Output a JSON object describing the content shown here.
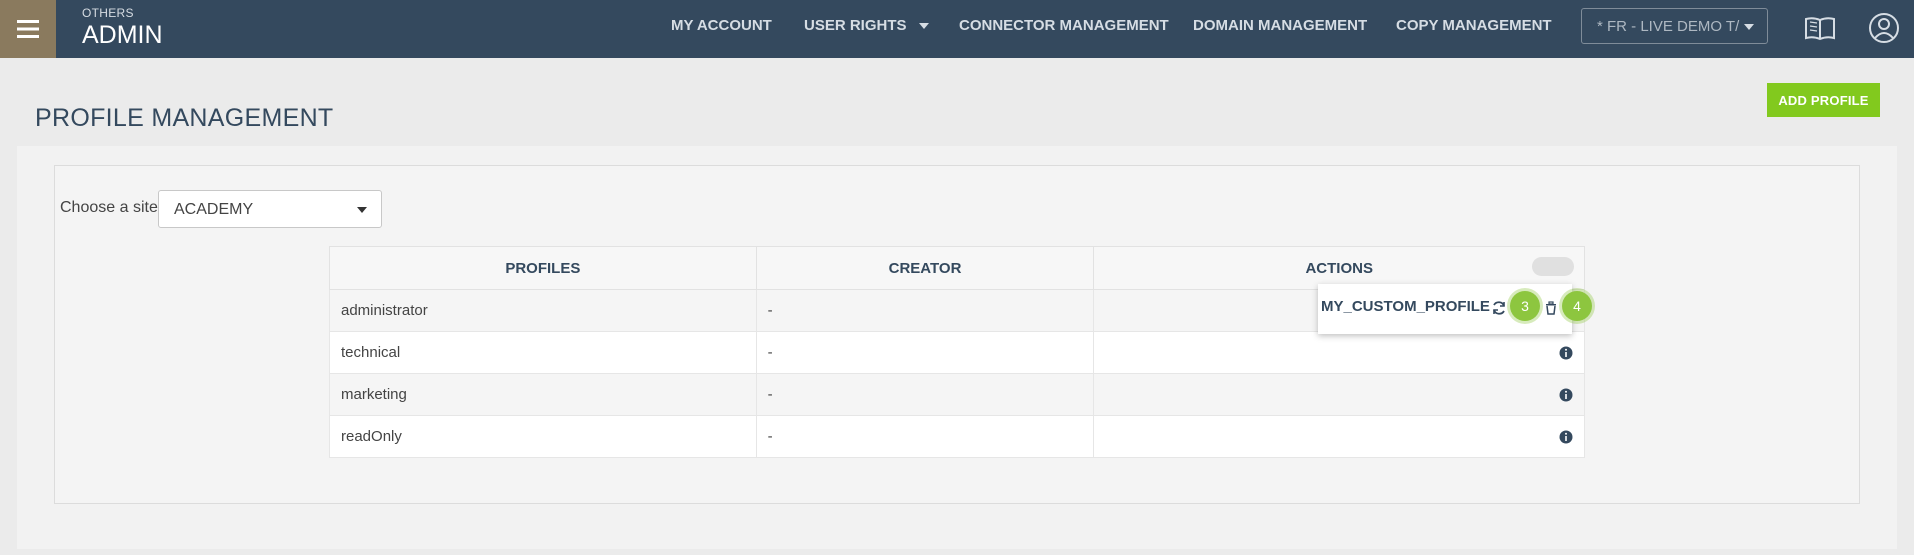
{
  "header": {
    "section_small": "OTHERS",
    "section_big": "ADMIN",
    "nav": [
      {
        "label": "MY ACCOUNT",
        "has_caret": false
      },
      {
        "label": "USER RIGHTS",
        "has_caret": true
      },
      {
        "label": "CONNECTOR MANAGEMENT",
        "has_caret": false
      },
      {
        "label": "DOMAIN MANAGEMENT",
        "has_caret": false
      },
      {
        "label": "COPY MANAGEMENT",
        "has_caret": false
      }
    ],
    "site_selector": "* FR - LIVE DEMO T/",
    "icons": [
      "book-icon",
      "user-icon"
    ]
  },
  "page": {
    "title": "PROFILE MANAGEMENT",
    "add_button": "ADD PROFILE"
  },
  "filter": {
    "label": "Choose a site:",
    "selected": "ACADEMY"
  },
  "table": {
    "columns": [
      "PROFILES",
      "CREATOR",
      "ACTIONS"
    ],
    "rows": [
      {
        "profile": "administrator",
        "creator": "-"
      },
      {
        "profile": "technical",
        "creator": "-"
      },
      {
        "profile": "marketing",
        "creator": "-"
      },
      {
        "profile": "readOnly",
        "creator": "-"
      }
    ]
  },
  "popover": {
    "name": "MY_CUSTOM_PROFILE",
    "badges": [
      "3",
      "4"
    ]
  },
  "colors": {
    "topbar": "#34495e",
    "burger": "#8a7a5e",
    "accent_green": "#82c91e",
    "badge_green": "#8dc63f"
  }
}
